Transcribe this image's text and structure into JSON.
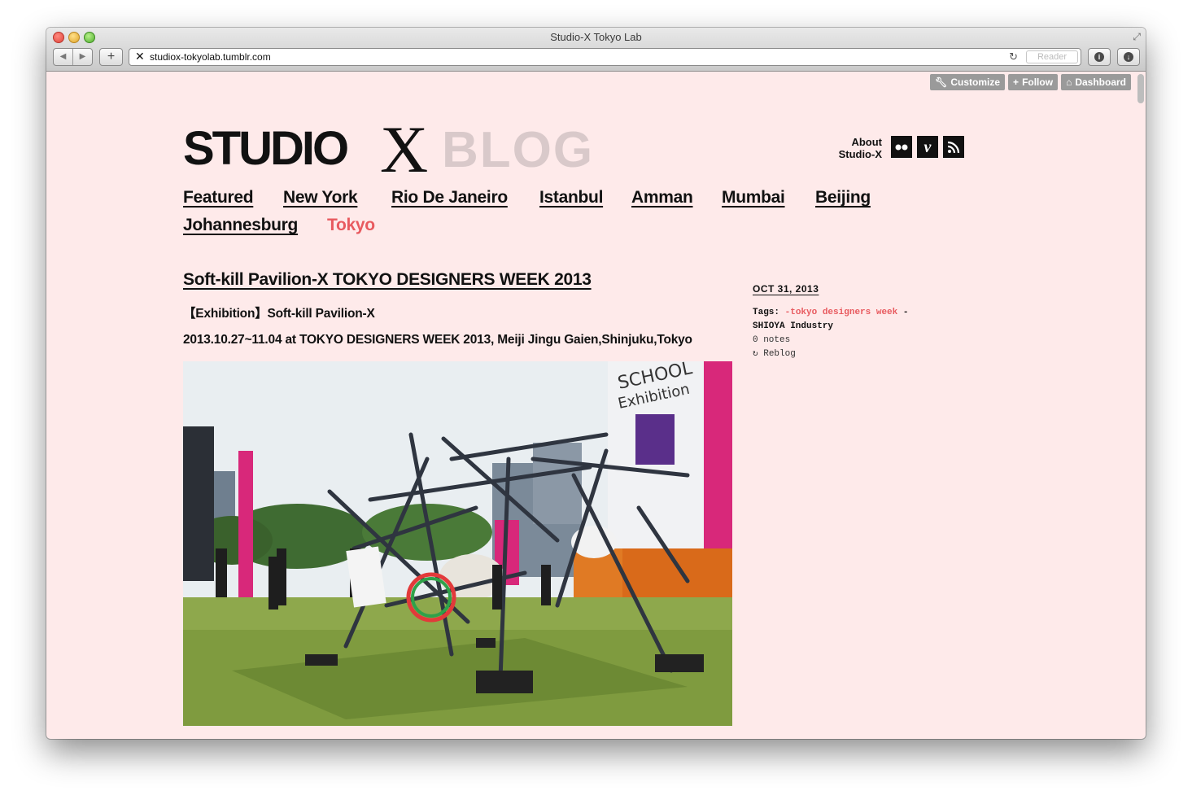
{
  "window": {
    "title": "Studio-X Tokyo Lab",
    "url": "studiox-tokyolab.tumblr.com",
    "reader_label": "Reader"
  },
  "tumblr": {
    "customize": "Customize",
    "follow": "Follow",
    "dashboard": "Dashboard"
  },
  "header": {
    "logo_main": "STUDIO",
    "logo_x": "X",
    "logo_sub": "BLOG",
    "about_line1": "About",
    "about_line2": "Studio-X"
  },
  "nav": {
    "items": [
      {
        "label": "Featured"
      },
      {
        "label": "New York"
      },
      {
        "label": "Rio De Janeiro"
      },
      {
        "label": "Istanbul"
      },
      {
        "label": "Amman"
      },
      {
        "label": "Mumbai"
      },
      {
        "label": "Beijing"
      },
      {
        "label": "Johannesburg"
      },
      {
        "label": "Tokyo",
        "active": true
      }
    ]
  },
  "post": {
    "title": "Soft-kill Pavilion-X TOKYO DESIGNERS WEEK 2013",
    "subtitle": "【Exhibition】Soft-kill Pavilion-X",
    "details": "2013.10.27~11.04 at TOKYO DESIGNERS WEEK 2013, Meiji Jingu Gaien,Shinjuku,Tokyo",
    "photo_sign_line1": "SCHOOL",
    "photo_sign_line2": "Exhibition"
  },
  "meta": {
    "date": "OCT 31, 2013",
    "tags_label": "Tags:",
    "tag1": "-tokyo designers week",
    "tag_sep": "-",
    "tag2": "SHIOYA Industry",
    "notes": "0 notes",
    "reblog": "Reblog"
  },
  "colors": {
    "page_bg": "#feeaea",
    "accent": "#e85a5f",
    "logo_blog": "#d9c9ca"
  }
}
